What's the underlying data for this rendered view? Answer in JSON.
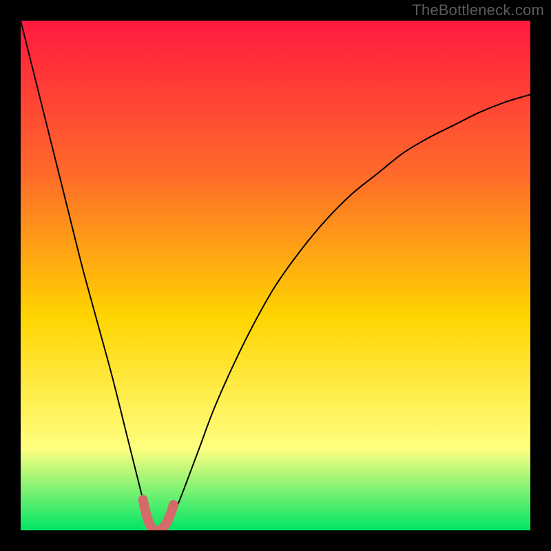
{
  "watermark": "TheBottleneck.com",
  "colors": {
    "frame": "#000000",
    "gradient_top": "#ff1a3f",
    "gradient_mid1": "#ff6a2a",
    "gradient_mid2": "#ffd400",
    "gradient_mid3": "#ffff80",
    "gradient_bottom": "#00e565",
    "curve": "#000000",
    "highlight": "#d46a6a"
  },
  "chart_data": {
    "type": "line",
    "title": "",
    "xlabel": "",
    "ylabel": "",
    "xlim": [
      0,
      100
    ],
    "ylim": [
      0,
      100
    ],
    "series": [
      {
        "name": "bottleneck-curve",
        "x": [
          0,
          3,
          6,
          9,
          12,
          15,
          18,
          21,
          24,
          25,
          26,
          27,
          28,
          29,
          30,
          32,
          35,
          38,
          42,
          46,
          50,
          55,
          60,
          65,
          70,
          75,
          80,
          85,
          90,
          95,
          100
        ],
        "y": [
          100,
          88,
          76,
          64,
          52,
          41,
          30,
          18,
          6,
          2,
          0,
          0,
          0,
          1,
          3,
          8,
          16,
          24,
          33,
          41,
          48,
          55,
          61,
          66,
          70,
          74,
          77,
          79.5,
          82,
          84,
          85.5
        ]
      },
      {
        "name": "optimal-zone-highlight",
        "x": [
          24,
          24.6,
          25.2,
          25.8,
          26.4,
          27,
          27.6,
          28.2,
          28.8,
          29.4,
          30
        ],
        "y": [
          6,
          3.3,
          1.5,
          0.4,
          0,
          0,
          0.2,
          0.8,
          1.8,
          3.2,
          5
        ]
      }
    ]
  }
}
